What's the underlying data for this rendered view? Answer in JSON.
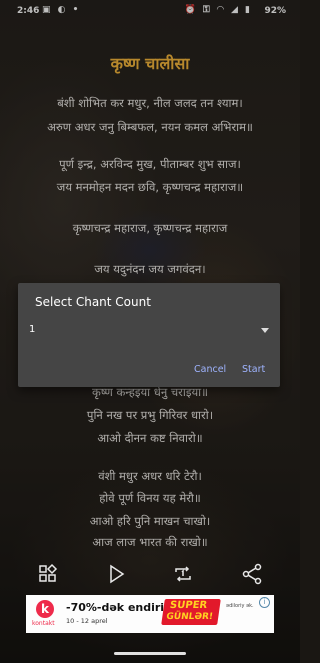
{
  "status_bar": {
    "time": "2:46",
    "battery": "92%",
    "left_icons": [
      "app-icon",
      "gesture-icon",
      "dot-icon"
    ],
    "right_icons": [
      "alarm-icon",
      "vpn-icon",
      "data-icon",
      "wifi-icon",
      "signal-icon",
      "battery-icon"
    ]
  },
  "page": {
    "title": "कृष्ण चालीसा"
  },
  "verses": [
    "बंशी शोभित कर मधुर, नील जलद तन श्याम।",
    "अरुण अधर जनु बिम्बफल, नयन कमल अभिराम॥",
    "पूर्ण इन्द्र, अरविन्द मुख, पीताम्बर शुभ साज।",
    "जय मनमोहन मदन छवि, कृष्णचन्द्र महाराज॥",
    "कृष्णचन्द्र महाराज, कृष्णचन्द्र महाराज",
    "जय यदुनंदन जय जगवंदन।",
    "कृष्ण कन्हइया धेनु चराइया॥",
    "पुनि नख पर प्रभु गिरिवर धारो।",
    "आओ दीनन कष्ट निवारो॥",
    "वंशी मधुर अधर धरि टेरौ।",
    "होवे पूर्ण विनय यह मेरौ॥",
    "आओ हरि पुनि माखन चाखो।",
    "आज लाज भारत की राखो॥"
  ],
  "dialog": {
    "title": "Select Chant Count",
    "selected_value": "1",
    "cancel_label": "Cancel",
    "start_label": "Start"
  },
  "toolbar": {
    "icons": [
      "grid-icon",
      "play-icon",
      "repeat-icon",
      "share-icon"
    ]
  },
  "ad": {
    "logo_letter": "k",
    "brand": "kontakt",
    "headline": "-70%-dək endirim",
    "dates": "10 - 12 aprel",
    "badge_line1": "SUPER",
    "badge_line2": "GÜNLƏR!",
    "side_text": "ədiloriy ək.",
    "info_icon": "i"
  }
}
